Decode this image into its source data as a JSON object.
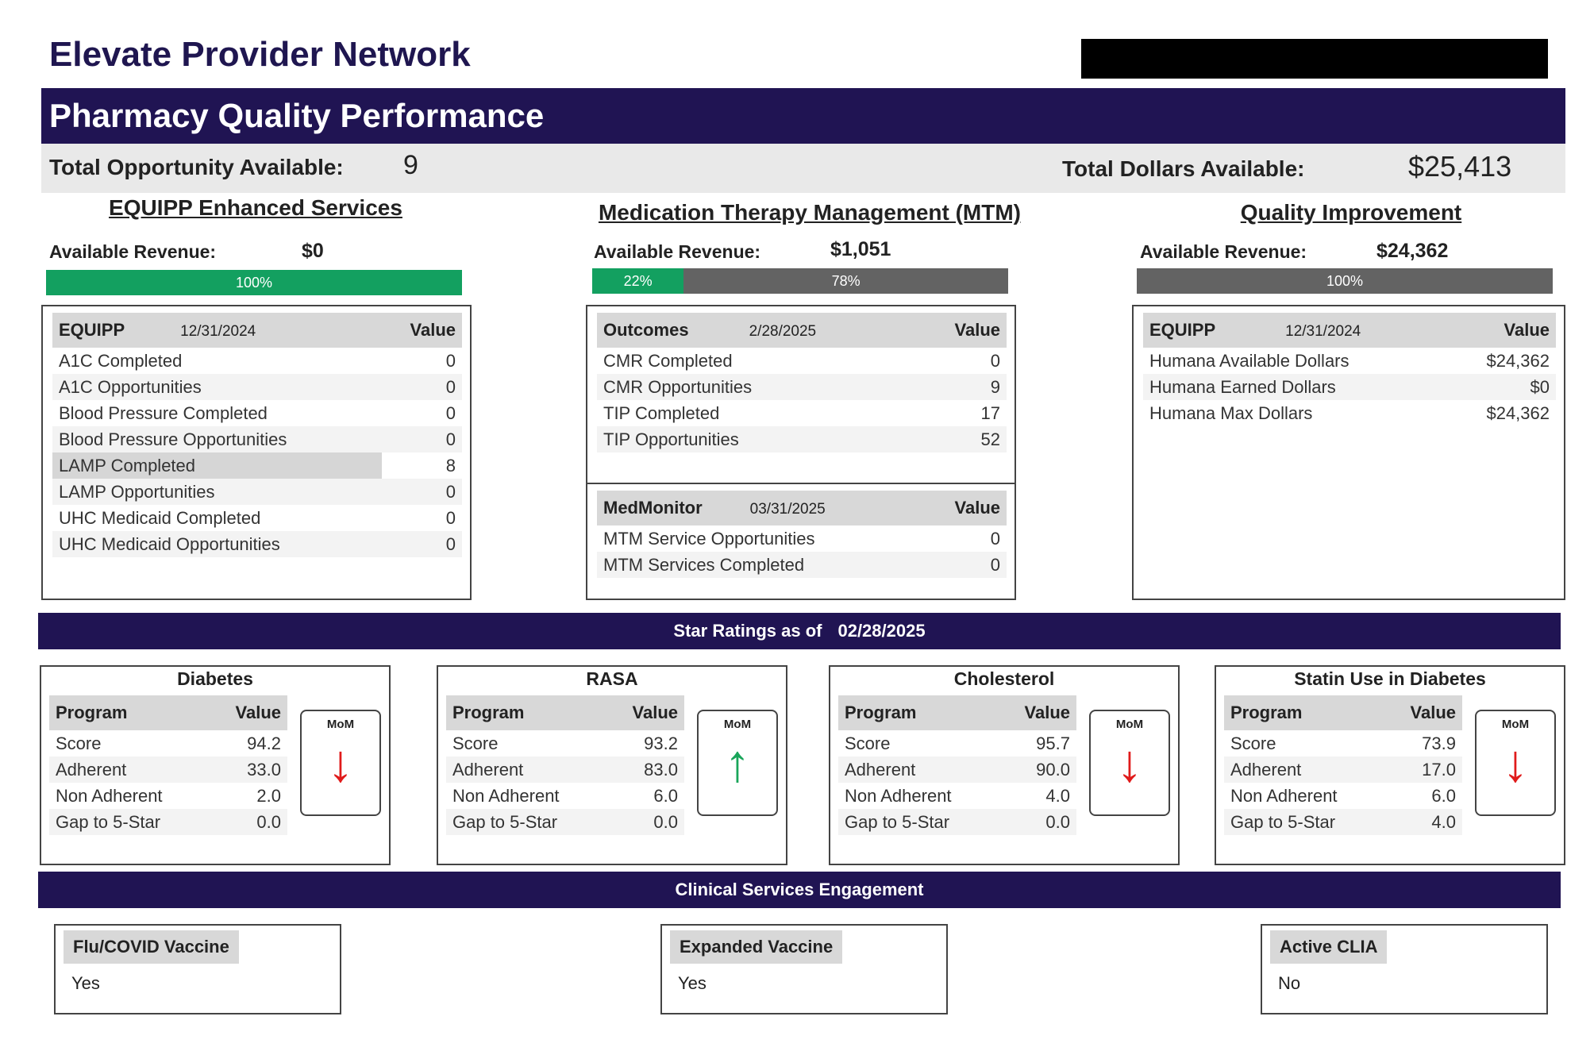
{
  "header": {
    "brand": "Elevate Provider Network",
    "title": "Pharmacy Quality Performance"
  },
  "totals": {
    "opportunity_label": "Total Opportunity Available:",
    "opportunity_value": "9",
    "dollars_label": "Total Dollars Available:",
    "dollars_value": "$25,413"
  },
  "equipp_section": {
    "title": "EQUIPP Enhanced Services",
    "revenue_label": "Available Revenue:",
    "revenue_value": "$0",
    "bar": [
      {
        "label": "100%",
        "fraction": 1.0,
        "color": "#13a060"
      }
    ],
    "table": {
      "header": "EQUIPP",
      "date": "12/31/2024",
      "value_header": "Value",
      "rows": [
        {
          "label": "A1C Completed",
          "value": "0"
        },
        {
          "label": "A1C Opportunities",
          "value": "0"
        },
        {
          "label": "Blood Pressure Completed",
          "value": "0"
        },
        {
          "label": "Blood Pressure Opportunities",
          "value": "0"
        },
        {
          "label": "LAMP Completed",
          "value": "8"
        },
        {
          "label": "LAMP Opportunities",
          "value": "0"
        },
        {
          "label": "UHC Medicaid Completed",
          "value": "0"
        },
        {
          "label": "UHC Medicaid Opportunities",
          "value": "0"
        }
      ]
    }
  },
  "mtm_section": {
    "title": "Medication Therapy Management (MTM)",
    "revenue_label": "Available Revenue:",
    "revenue_value": "$1,051",
    "bar": [
      {
        "label": "22%",
        "fraction": 0.22,
        "color": "#13a060"
      },
      {
        "label": "78%",
        "fraction": 0.78,
        "color": "#636363"
      }
    ],
    "outcomes": {
      "header": "Outcomes",
      "date": "2/28/2025",
      "value_header": "Value",
      "rows": [
        {
          "label": "CMR Completed",
          "value": "0"
        },
        {
          "label": "CMR Opportunities",
          "value": "9"
        },
        {
          "label": "TIP Completed",
          "value": "17"
        },
        {
          "label": "TIP Opportunities",
          "value": "52"
        }
      ]
    },
    "medmonitor": {
      "header": "MedMonitor",
      "date": "03/31/2025",
      "value_header": "Value",
      "rows": [
        {
          "label": "MTM Service Opportunities",
          "value": "0"
        },
        {
          "label": "MTM Services Completed",
          "value": "0"
        }
      ]
    }
  },
  "qi_section": {
    "title": "Quality Improvement",
    "revenue_label": "Available Revenue:",
    "revenue_value": "$24,362",
    "bar": [
      {
        "label": "100%",
        "fraction": 1.0,
        "color": "#636363"
      }
    ],
    "table": {
      "header": "EQUIPP",
      "date": "12/31/2024",
      "value_header": "Value",
      "rows": [
        {
          "label": "Humana Available Dollars",
          "value": "$24,362"
        },
        {
          "label": "Humana Earned Dollars",
          "value": "$0"
        },
        {
          "label": "Humana Max Dollars",
          "value": "$24,362"
        }
      ]
    }
  },
  "star_ratings": {
    "banner_label": "Star Ratings as of",
    "banner_date": "02/28/2025",
    "cards": [
      {
        "title": "Diabetes",
        "program_header": "Program",
        "value_header": "Value",
        "mom_label": "MoM",
        "trend": "down",
        "arrow": "↓",
        "rows": [
          {
            "label": "Score",
            "value": "94.2"
          },
          {
            "label": "Adherent",
            "value": "33.0"
          },
          {
            "label": "Non Adherent",
            "value": "2.0"
          },
          {
            "label": "Gap to 5-Star",
            "value": "0.0"
          }
        ]
      },
      {
        "title": "RASA",
        "program_header": "Program",
        "value_header": "Value",
        "mom_label": "MoM",
        "trend": "up",
        "arrow": "↑",
        "rows": [
          {
            "label": "Score",
            "value": "93.2"
          },
          {
            "label": "Adherent",
            "value": "83.0"
          },
          {
            "label": "Non Adherent",
            "value": "6.0"
          },
          {
            "label": "Gap to 5-Star",
            "value": "0.0"
          }
        ]
      },
      {
        "title": "Cholesterol",
        "program_header": "Program",
        "value_header": "Value",
        "mom_label": "MoM",
        "trend": "down",
        "arrow": "↓",
        "rows": [
          {
            "label": "Score",
            "value": "95.7"
          },
          {
            "label": "Adherent",
            "value": "90.0"
          },
          {
            "label": "Non Adherent",
            "value": "4.0"
          },
          {
            "label": "Gap to 5-Star",
            "value": "0.0"
          }
        ]
      },
      {
        "title": "Statin Use in Diabetes",
        "program_header": "Program",
        "value_header": "Value",
        "mom_label": "MoM",
        "trend": "down",
        "arrow": "↓",
        "rows": [
          {
            "label": "Score",
            "value": "73.9"
          },
          {
            "label": "Adherent",
            "value": "17.0"
          },
          {
            "label": "Non Adherent",
            "value": "6.0"
          },
          {
            "label": "Gap to 5-Star",
            "value": "4.0"
          }
        ]
      }
    ]
  },
  "clinical": {
    "banner": "Clinical Services Engagement",
    "cards": [
      {
        "label": "Flu/COVID Vaccine",
        "value": "Yes"
      },
      {
        "label": "Expanded Vaccine",
        "value": "Yes"
      },
      {
        "label": "Active CLIA",
        "value": "No"
      }
    ]
  },
  "colors": {
    "navy": "#201453",
    "green": "#13a060",
    "gray": "#636363",
    "down": "#e01b1b",
    "up": "#19a55a"
  }
}
